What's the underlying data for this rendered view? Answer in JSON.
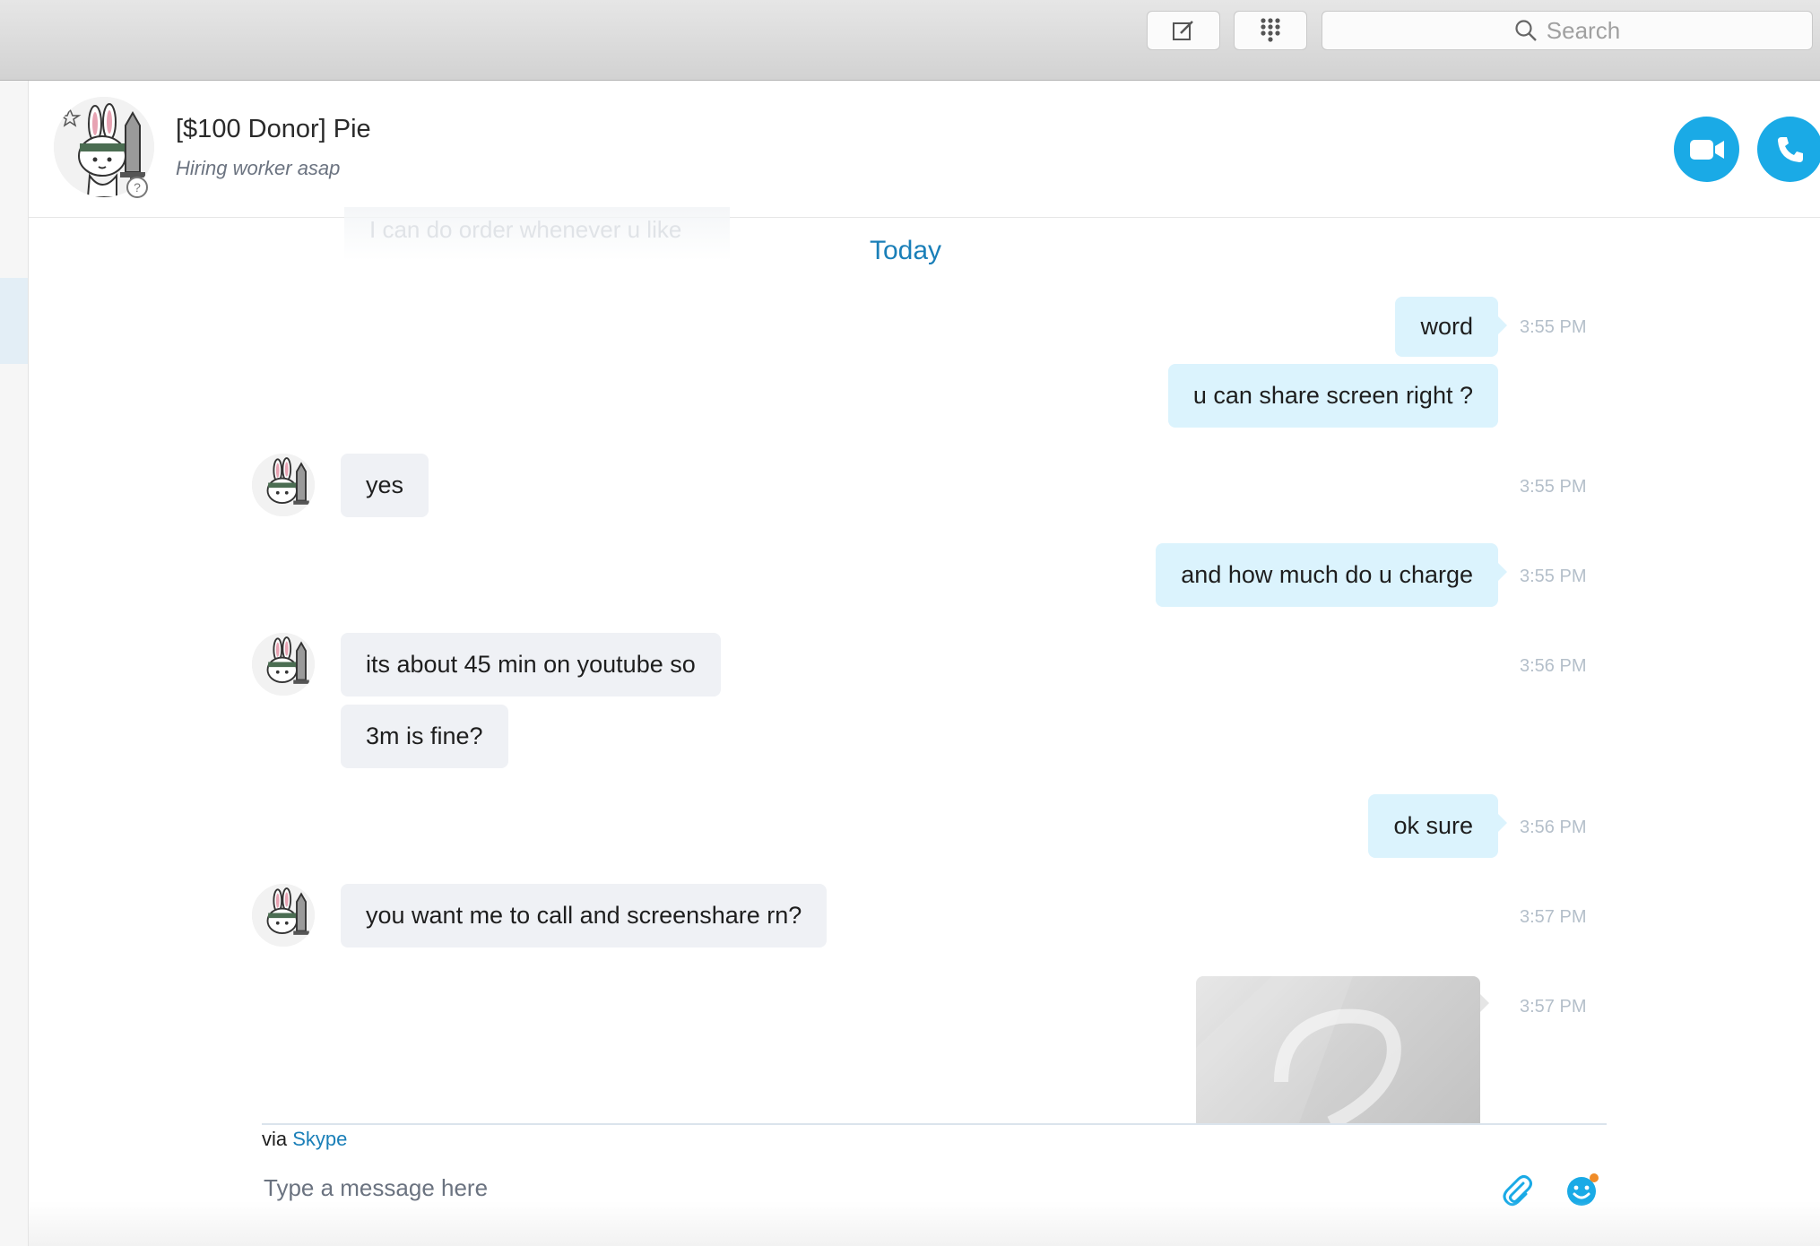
{
  "toolbar": {
    "compose_icon": "compose-icon",
    "dialpad_icon": "dialpad-icon",
    "search_placeholder": "Search"
  },
  "contact": {
    "name": "[$100 Donor] Pie",
    "mood": "Hiring worker asap"
  },
  "chat": {
    "faded_previous": "I can do order whenever u like",
    "date_separator": "Today",
    "messages": [
      {
        "from": "me",
        "text": "word",
        "time": "3:55 PM"
      },
      {
        "from": "me",
        "text": "u can share screen right ?",
        "time": ""
      },
      {
        "from": "them",
        "text": "yes",
        "time": "3:55 PM"
      },
      {
        "from": "me",
        "text": "and how much do u charge",
        "time": "3:55 PM"
      },
      {
        "from": "them",
        "text": "its about 45 min on youtube so",
        "time": "3:56 PM"
      },
      {
        "from": "them",
        "text": "3m is fine?",
        "time": ""
      },
      {
        "from": "me",
        "text": "ok sure",
        "time": "3:56 PM"
      },
      {
        "from": "them",
        "text": "you want me to call and screenshare rn?",
        "time": "3:57 PM"
      },
      {
        "from": "me",
        "text": "",
        "time": "3:57 PM",
        "type": "image"
      }
    ]
  },
  "composer": {
    "via_prefix": "via",
    "via_link": "Skype",
    "placeholder": "Type a message here"
  },
  "colors": {
    "accent": "#1aaae6",
    "link": "#1a7fb8",
    "my_bubble": "#dbf3fd",
    "their_bubble": "#eff1f5"
  }
}
